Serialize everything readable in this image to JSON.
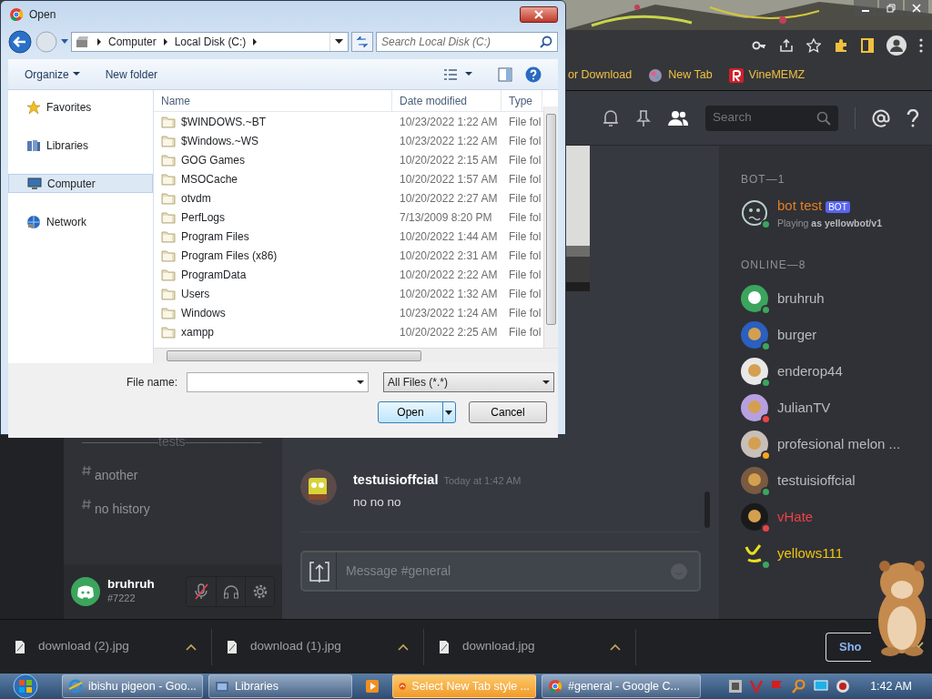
{
  "browser": {
    "bookmarks": [
      {
        "label": "or Download"
      },
      {
        "label": "New Tab"
      },
      {
        "label": "VineMEMZ"
      }
    ]
  },
  "discord": {
    "header": {
      "search_placeholder": "Search"
    },
    "channels": [
      {
        "label": "——————tests——————",
        "kind": "category"
      },
      {
        "label": "another",
        "kind": "channel"
      },
      {
        "label": "no history",
        "kind": "channel"
      }
    ],
    "user": {
      "name": "bruhruh",
      "tag": "#7222",
      "muted": true
    },
    "messages": [
      {
        "author": "testuisioffcial",
        "time": "Today at 1:42 AM",
        "text": "no no no"
      }
    ],
    "composer": {
      "placeholder": "Message #general"
    },
    "member_groups": [
      {
        "heading": "BOT—1",
        "members": [
          {
            "name": "bot test",
            "badge": "BOT",
            "activity": "Playing **as yellowbot/v1**",
            "color": "#e67e22",
            "status_dot": {
              "color": "#3ba55d"
            }
          }
        ]
      },
      {
        "heading": "ONLINE—8",
        "members": [
          {
            "name": "bruhruh",
            "color": "#b9bbbe",
            "status_dot": {
              "color": "#3ba55d"
            }
          },
          {
            "name": "burger",
            "color": "#b9bbbe",
            "status_dot": {
              "color": "#3ba55d"
            }
          },
          {
            "name": "enderop44",
            "color": "#b9bbbe",
            "status_dot": {
              "color": "#3ba55d"
            }
          },
          {
            "name": "JulianTV",
            "color": "#b9bbbe",
            "status_dot": {
              "color": "#ed4245"
            }
          },
          {
            "name": "profesional melon ...",
            "color": "#b9bbbe",
            "status_dot": {
              "color": "#faa61a"
            }
          },
          {
            "name": "testuisioffcial",
            "color": "#b9bbbe",
            "status_dot": {
              "color": "#3ba55d"
            }
          },
          {
            "name": "vHate",
            "color": "#ed4245",
            "status_dot": {
              "color": "#ed4245"
            }
          },
          {
            "name": "yellows111",
            "color": "#f1c40f",
            "status_dot": {
              "color": "#3ba55d"
            }
          }
        ]
      }
    ]
  },
  "downloads": {
    "items": [
      "download (2).jpg",
      "download (1).jpg",
      "download.jpg"
    ],
    "show_all": "Sho"
  },
  "dialog": {
    "title": "Open",
    "breadcrumb": [
      "Computer",
      "Local Disk (C:)"
    ],
    "search_placeholder": "Search Local Disk (C:)",
    "toolbar": [
      "Organize",
      "New folder"
    ],
    "nav": [
      {
        "label": "Favorites",
        "selected": false
      },
      {
        "label": "Libraries",
        "selected": false
      },
      {
        "label": "Computer",
        "selected": true
      },
      {
        "label": "Network",
        "selected": false
      }
    ],
    "columns": [
      "Name",
      "Date modified",
      "Type"
    ],
    "rows": [
      {
        "name": "$WINDOWS.~BT",
        "date": "10/23/2022 1:22 AM",
        "type": "File fol"
      },
      {
        "name": "$Windows.~WS",
        "date": "10/23/2022 1:22 AM",
        "type": "File fol"
      },
      {
        "name": "GOG Games",
        "date": "10/20/2022 2:15 AM",
        "type": "File fol"
      },
      {
        "name": "MSOCache",
        "date": "10/20/2022 1:57 AM",
        "type": "File fol"
      },
      {
        "name": "otvdm",
        "date": "10/20/2022 2:27 AM",
        "type": "File fol"
      },
      {
        "name": "PerfLogs",
        "date": "7/13/2009 8:20 PM",
        "type": "File fol"
      },
      {
        "name": "Program Files",
        "date": "10/20/2022 1:44 AM",
        "type": "File fol"
      },
      {
        "name": "Program Files (x86)",
        "date": "10/20/2022 2:31 AM",
        "type": "File fol"
      },
      {
        "name": "ProgramData",
        "date": "10/20/2022 2:22 AM",
        "type": "File fol"
      },
      {
        "name": "Users",
        "date": "10/20/2022 1:32 AM",
        "type": "File fol"
      },
      {
        "name": "Windows",
        "date": "10/23/2022 1:24 AM",
        "type": "File fol"
      },
      {
        "name": "xampp",
        "date": "10/20/2022 2:25 AM",
        "type": "File fol"
      }
    ],
    "file_name_label": "File name:",
    "filter": "All Files (*.*)",
    "buttons": [
      "Open",
      "Cancel"
    ]
  },
  "taskbar": {
    "tasks": [
      {
        "kind": "button",
        "label": "ibishu pigeon - Goo...",
        "flashing": false
      },
      {
        "kind": "button",
        "label": "Libraries",
        "flashing": false
      },
      {
        "kind": "icon-only"
      },
      {
        "kind": "button",
        "label": "Select New Tab style ...",
        "flashing": true
      },
      {
        "kind": "button",
        "label": "#general - Google C...",
        "flashing": false
      }
    ],
    "clock": "1:42 AM"
  }
}
